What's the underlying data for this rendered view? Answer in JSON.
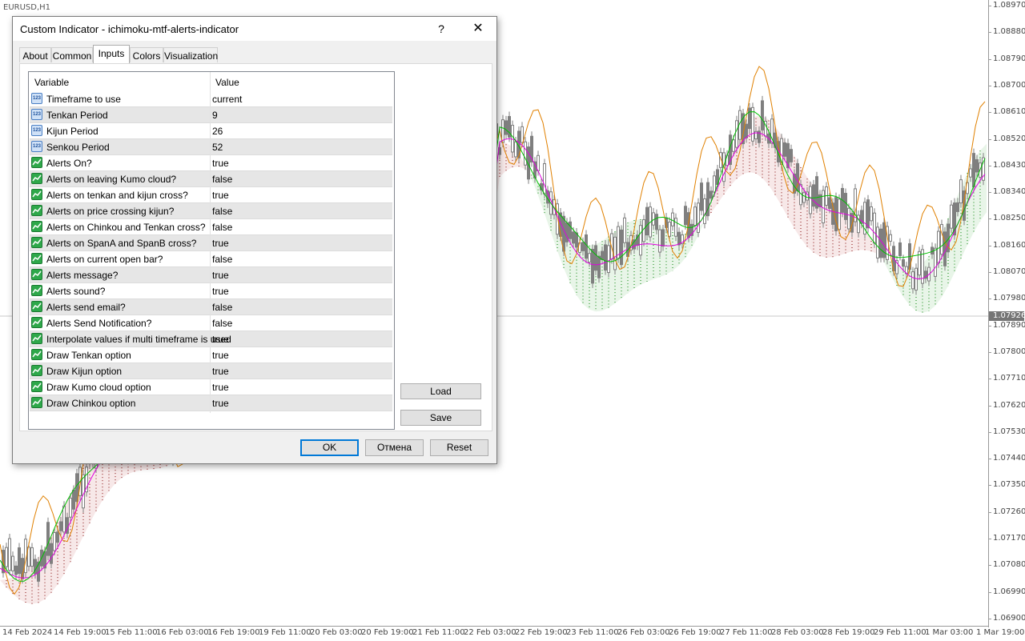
{
  "chart": {
    "symbol": "EURUSD,H1",
    "price_labels": [
      "1.08970",
      "1.08880",
      "1.08790",
      "1.08700",
      "1.08610",
      "1.08520",
      "1.08430",
      "1.08340",
      "1.08250",
      "1.08160",
      "1.08070",
      "1.07980",
      "1.07890",
      "1.07800",
      "1.07710",
      "1.07620",
      "1.07530",
      "1.07440",
      "1.07350",
      "1.07260",
      "1.07170",
      "1.07080",
      "1.06990",
      "1.06900"
    ],
    "current_price": "1.07926",
    "time_labels": [
      "14 Feb 2024",
      "14 Feb 19:00",
      "15 Feb 11:00",
      "16 Feb 03:00",
      "16 Feb 19:00",
      "19 Feb 11:00",
      "20 Feb 03:00",
      "20 Feb 19:00",
      "21 Feb 11:00",
      "22 Feb 03:00",
      "22 Feb 19:00",
      "23 Feb 11:00",
      "26 Feb 03:00",
      "26 Feb 19:00",
      "27 Feb 11:00",
      "28 Feb 03:00",
      "28 Feb 19:00",
      "29 Feb 11:00",
      "1 Mar 03:00",
      "1 Mar 19:00"
    ],
    "colors": {
      "tenkan": "#00c000",
      "kijun": "#e000e0",
      "chinkou": "#e08000",
      "candle": "#7f7f7f",
      "cloud_up": "#008000",
      "cloud_down": "#800000"
    }
  },
  "dialog": {
    "title": "Custom Indicator - ichimoku-mtf-alerts-indicator",
    "help_glyph": "?",
    "close_glyph": "✕",
    "tabs": [
      "About",
      "Common",
      "Inputs",
      "Colors",
      "Visualization"
    ],
    "active_tab": "Inputs",
    "grid": {
      "col_variable": "Variable",
      "col_value": "Value",
      "rows": [
        {
          "name": "Timeframe to use",
          "value": "current",
          "icon": "number-icon"
        },
        {
          "name": "Tenkan Period",
          "value": "9",
          "icon": "number-icon"
        },
        {
          "name": "Kijun Period",
          "value": "26",
          "icon": "number-icon"
        },
        {
          "name": "Senkou Period",
          "value": "52",
          "icon": "number-icon"
        },
        {
          "name": "Alerts On?",
          "value": "true",
          "icon": "bool-icon"
        },
        {
          "name": "Alerts on leaving Kumo cloud?",
          "value": "false",
          "icon": "bool-icon"
        },
        {
          "name": "Alerts on tenkan and kijun cross?",
          "value": "true",
          "icon": "bool-icon"
        },
        {
          "name": "Alerts on price crossing kijun?",
          "value": "false",
          "icon": "bool-icon"
        },
        {
          "name": "Alerts on Chinkou and Tenkan cross?",
          "value": "false",
          "icon": "bool-icon"
        },
        {
          "name": "Alerts on SpanA and SpanB cross?",
          "value": "true",
          "icon": "bool-icon"
        },
        {
          "name": "Alerts on current open bar?",
          "value": "false",
          "icon": "bool-icon"
        },
        {
          "name": "Alerts message?",
          "value": "true",
          "icon": "bool-icon"
        },
        {
          "name": "Alerts sound?",
          "value": "true",
          "icon": "bool-icon"
        },
        {
          "name": "Alerts send email?",
          "value": "false",
          "icon": "bool-icon"
        },
        {
          "name": "Alerts Send Notification?",
          "value": "false",
          "icon": "bool-icon"
        },
        {
          "name": "Interpolate values if multi timeframe is used",
          "value": "true",
          "icon": "bool-icon"
        },
        {
          "name": "Draw Tenkan option",
          "value": "true",
          "icon": "bool-icon"
        },
        {
          "name": "Draw Kijun option",
          "value": "true",
          "icon": "bool-icon"
        },
        {
          "name": "Draw Kumo cloud option",
          "value": "true",
          "icon": "bool-icon"
        },
        {
          "name": "Draw Chinkou option",
          "value": "true",
          "icon": "bool-icon"
        }
      ],
      "number_icon_text": "123"
    },
    "side_buttons": {
      "load": "Load",
      "save": "Save"
    },
    "buttons": {
      "ok": "OK",
      "cancel": "Отмена",
      "reset": "Reset"
    }
  }
}
